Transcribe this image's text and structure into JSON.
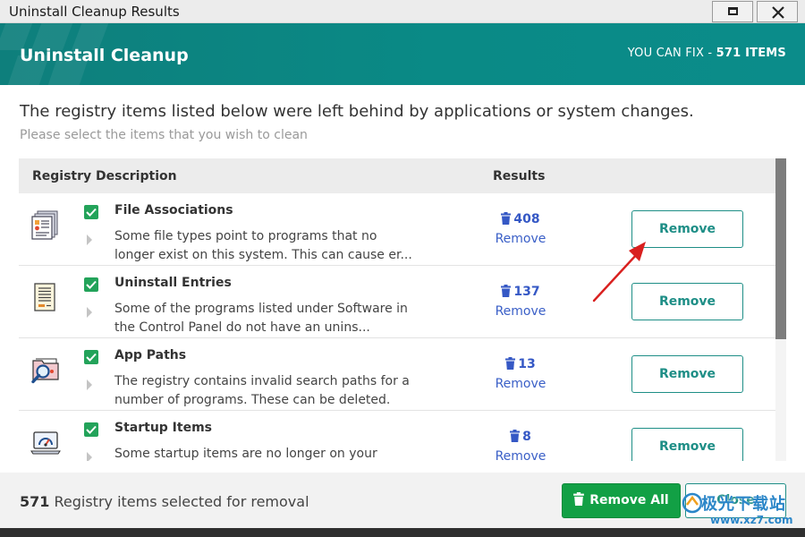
{
  "window": {
    "title": "Uninstall Cleanup Results"
  },
  "header": {
    "title": "Uninstall Cleanup",
    "fix_label": "YOU CAN FIX - ",
    "fix_count": "571 ITEMS"
  },
  "intro": {
    "title": "The registry items listed below were left behind by applications or system changes.",
    "subtitle": "Please select the items that you wish to clean"
  },
  "table": {
    "columns": [
      "Registry Description",
      "Results"
    ],
    "rows": [
      {
        "title": "File Associations",
        "description": "Some file types point to programs that no longer exist on this system. This can cause er...",
        "count": "408",
        "link": "Remove",
        "button": "Remove",
        "icon": "file-associations-icon",
        "checked": true
      },
      {
        "title": "Uninstall Entries",
        "description": "Some of the programs listed under Software in the Control Panel do not have an unins...",
        "count": "137",
        "link": "Remove",
        "button": "Remove",
        "icon": "uninstall-entries-icon",
        "checked": true
      },
      {
        "title": "App Paths",
        "description": "The registry contains invalid search paths for a number of programs. These can be deleted.",
        "count": "13",
        "link": "Remove",
        "button": "Remove",
        "icon": "app-paths-icon",
        "checked": true
      },
      {
        "title": "Startup Items",
        "description": "Some startup items are no longer on your",
        "count": "8",
        "link": "Remove",
        "button": "Remove",
        "icon": "startup-items-icon",
        "checked": true
      }
    ]
  },
  "footer": {
    "selected_count": "571",
    "selected_text": " Registry items selected for removal",
    "remove_all_label": "Remove All",
    "close_label": "Close"
  },
  "watermark": {
    "text": "极光下载站",
    "url": "www.xz7.com"
  },
  "colors": {
    "teal": "#0b8c8a",
    "green": "#12a045",
    "link_blue": "#3a5fc7",
    "arrow_red": "#d9201f"
  }
}
